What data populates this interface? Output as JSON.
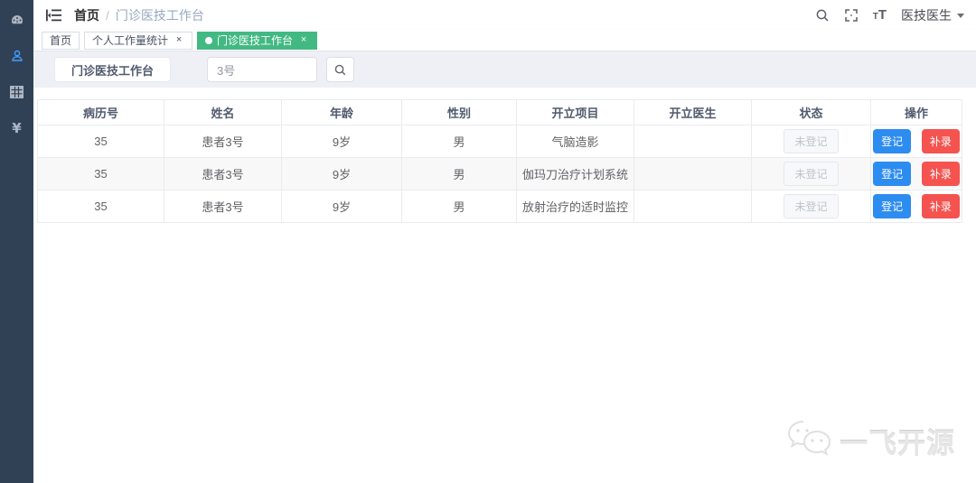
{
  "colors": {
    "sidebar_bg": "#304156",
    "accent_green": "#42b983",
    "primary_blue": "#2d8cf0",
    "danger_red": "#f4534f",
    "active_icon_blue": "#409eff"
  },
  "sidebar": {
    "items": [
      {
        "icon": "dashboard-icon",
        "active": false
      },
      {
        "icon": "user-icon",
        "active": true
      },
      {
        "icon": "table-icon",
        "active": false
      },
      {
        "icon": "money-icon",
        "active": false
      }
    ]
  },
  "header": {
    "breadcrumb": {
      "root": "首页",
      "separator": "/",
      "current": "门诊医技工作台"
    },
    "user_menu": "医技医生"
  },
  "tabs": [
    {
      "label": "首页",
      "active": false,
      "closable": false
    },
    {
      "label": "个人工作量统计",
      "active": false,
      "closable": true
    },
    {
      "label": "门诊医技工作台",
      "active": true,
      "closable": true
    }
  ],
  "toolbar": {
    "title_button": "门诊医技工作台",
    "search_value": "3号"
  },
  "table": {
    "columns": [
      "病历号",
      "姓名",
      "年龄",
      "性别",
      "开立项目",
      "开立医生",
      "状态",
      "操作"
    ],
    "rows": [
      {
        "record_no": "35",
        "name": "患者3号",
        "age": "9岁",
        "gender": "男",
        "project": "气脑造影",
        "doctor": "",
        "status": "未登记"
      },
      {
        "record_no": "35",
        "name": "患者3号",
        "age": "9岁",
        "gender": "男",
        "project": "伽玛刀治疗计划系统",
        "doctor": "",
        "status": "未登记"
      },
      {
        "record_no": "35",
        "name": "患者3号",
        "age": "9岁",
        "gender": "男",
        "project": "放射治疗的适时监控",
        "doctor": "",
        "status": "未登记"
      }
    ],
    "actions": {
      "register": "登记",
      "makeup": "补录"
    }
  },
  "watermark": {
    "text": "一飞开源"
  }
}
